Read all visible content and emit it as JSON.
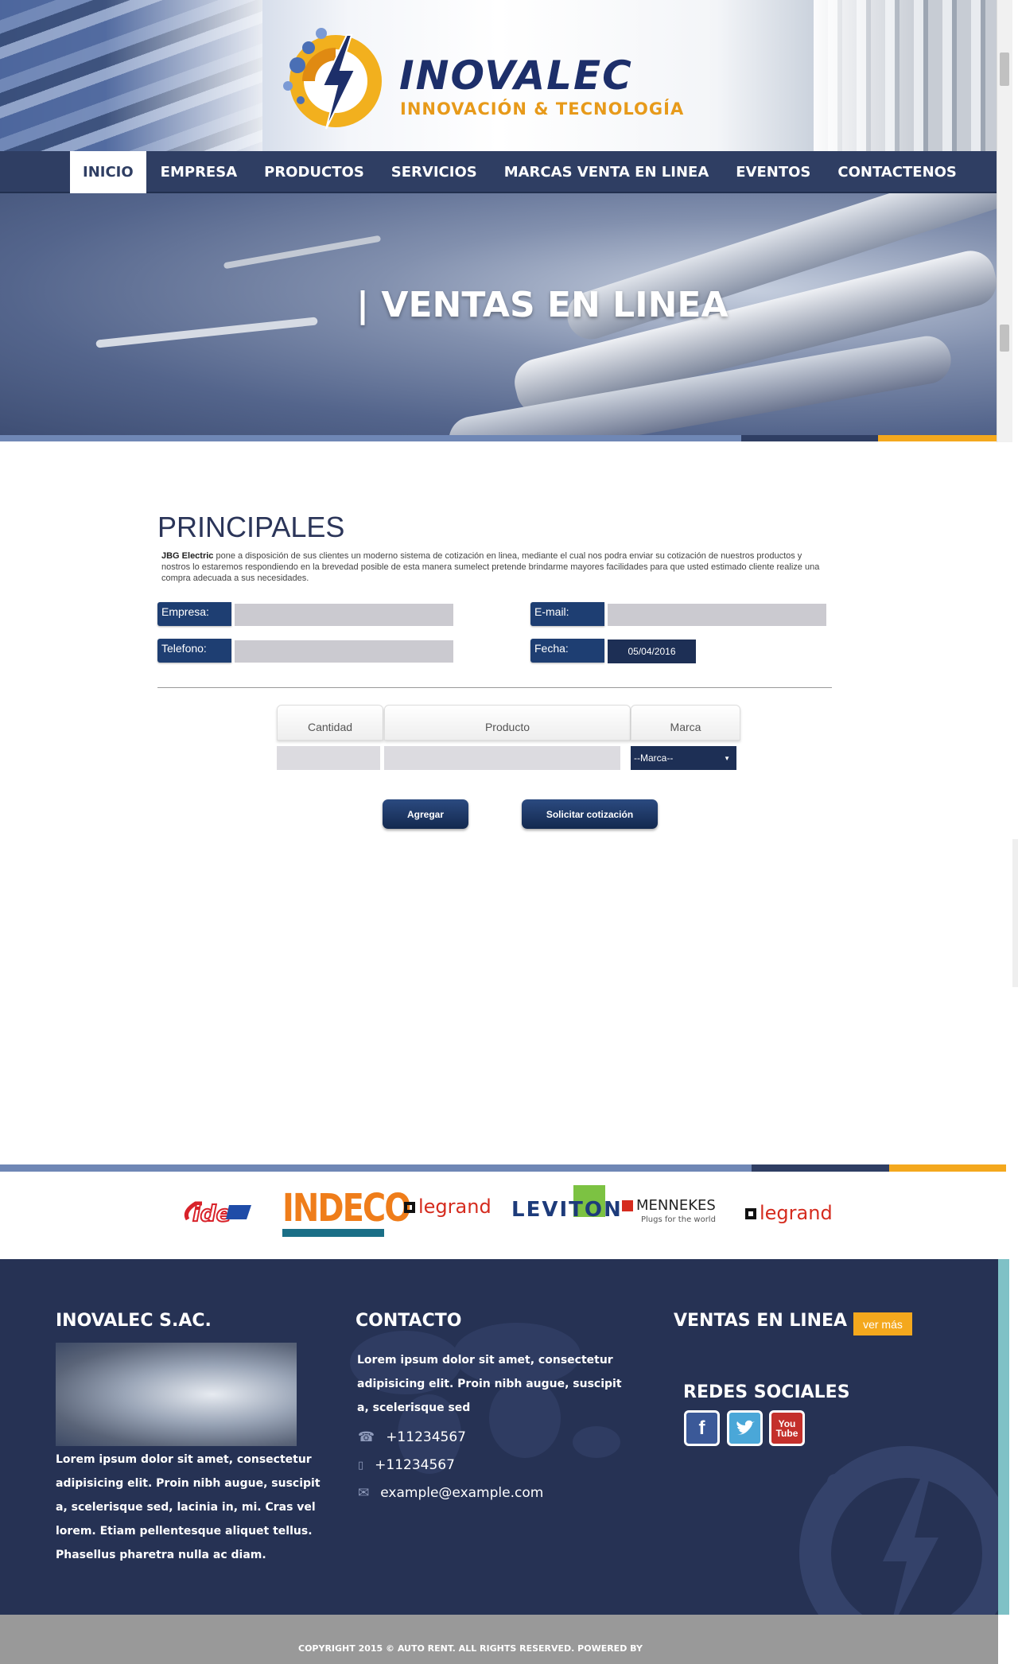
{
  "brand": {
    "name": "INOVALEC",
    "tagline": "INNOVACIÓN & TECNOLOGÍA"
  },
  "nav": {
    "items": [
      "INICIO",
      "EMPRESA",
      "PRODUCTOS",
      "SERVICIOS",
      "MARCAS VENTA EN LINEA",
      "EVENTOS",
      "CONTACTENOS"
    ],
    "active": "INICIO"
  },
  "banner": {
    "title": "| VENTAS EN LINEA"
  },
  "section": {
    "title": "PRINCIPALES",
    "intro_strong": "JBG Electric",
    "intro_rest": " pone a disposición de sus clientes un moderno sistema de cotización en linea, mediante el cual nos podra enviar su cotización de nuestros productos y nostros lo estaremos respondiendo en la brevedad posible de esta manera sumelect pretende brindarme mayores facilidades para que usted estimado cliente realize una compra adecuada a sus necesidades."
  },
  "form": {
    "empresa_label": "Empresa:",
    "email_label": "E-mail:",
    "telefono_label": "Telefono:",
    "fecha_label": "Fecha:",
    "fecha_value": "05/04/2016",
    "empresa_value": "",
    "email_value": "",
    "telefono_value": ""
  },
  "table": {
    "col_cantidad": "Cantidad",
    "col_producto": "Producto",
    "col_marca": "Marca",
    "marca_selected": "--Marca--"
  },
  "buttons": {
    "agregar": "Agregar",
    "solicitar": "Solicitar cotización"
  },
  "brands": [
    "INDECO",
    "legrand",
    "LEVITON",
    "MENNEKES",
    "Plugs for the world",
    "legrand"
  ],
  "footer": {
    "company_title": "INOVALEC S.AC.",
    "company_text": "Lorem ipsum dolor sit amet, consectetur adipisicing elit. Proin nibh augue, suscipit a, scelerisque sed, lacinia in, mi. Cras vel lorem. Etiam pellentesque aliquet tellus. Phasellus pharetra nulla ac diam.",
    "contact_title": "CONTACTO",
    "contact_text": "Lorem ipsum dolor sit amet, consectetur adipisicing elit. Proin nibh augue, suscipit a, scelerisque sed",
    "phone1": "+11234567",
    "phone2": "+11234567",
    "email": "example@example.com",
    "ventas_title": "VENTAS EN LINEA",
    "ver_mas": "ver más",
    "redes_title": "REDES SOCIALES",
    "social": [
      "facebook",
      "twitter",
      "youtube"
    ]
  },
  "copyright": "COPYRIGHT 2015 © AUTO RENT. ALL RIGHTS RESERVED.  POWERED BY",
  "colors": {
    "navy": "#2f3e63",
    "footer": "#263254",
    "accent": "#f4a81d",
    "label_blue": "#1e3e72"
  }
}
